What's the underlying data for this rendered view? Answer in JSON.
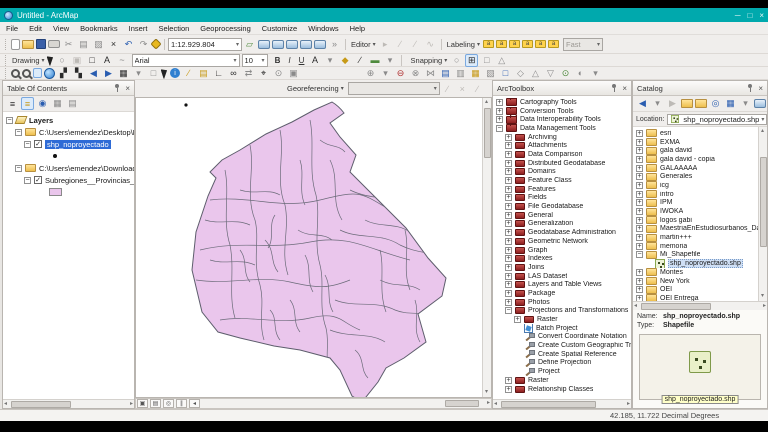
{
  "window": {
    "title": "Untitled - ArcMap"
  },
  "menu": [
    "File",
    "Edit",
    "View",
    "Bookmarks",
    "Insert",
    "Selection",
    "Geoprocessing",
    "Customize",
    "Windows",
    "Help"
  ],
  "toolbar1": {
    "scale": "1:12.929.804",
    "editor_label": "Editor",
    "labeling_label": "Labeling",
    "fast_value": "Fast",
    "icons_file": [
      {
        "n": "new-map",
        "c": "sh-page"
      },
      {
        "n": "open",
        "c": "sh-folder"
      },
      {
        "n": "save",
        "c": "sh-floppy"
      },
      {
        "n": "print",
        "c": "sh-print"
      },
      {
        "n": "cut",
        "g": "✂",
        "c": "gry"
      },
      {
        "n": "copy",
        "g": "▤",
        "c": "gry"
      },
      {
        "n": "paste",
        "g": "▨",
        "c": "gry"
      },
      {
        "n": "delete",
        "g": "×",
        "c": "blk"
      },
      {
        "n": "undo",
        "g": "↶",
        "c": "blu"
      },
      {
        "n": "redo",
        "g": "↷",
        "c": "gry"
      },
      {
        "n": "add-data",
        "c": "sh-diamond"
      }
    ],
    "icons_map": [
      {
        "n": "map-scale-assistant",
        "g": "▱",
        "c": "grn"
      },
      {
        "n": "table-of-contents-window",
        "c": "sh-win"
      },
      {
        "n": "catalog-window",
        "c": "sh-win"
      },
      {
        "n": "search-window",
        "c": "sh-win"
      },
      {
        "n": "arctoolbox-window",
        "c": "sh-win"
      },
      {
        "n": "python-window",
        "c": "sh-win"
      },
      {
        "n": "model-builder",
        "g": "»",
        "c": "gry"
      }
    ],
    "icons_editor": [
      {
        "n": "edit-tool",
        "g": "▸",
        "c": "dis"
      },
      {
        "n": "edit-annotation-tool",
        "g": "∕",
        "c": "dis"
      },
      {
        "n": "straight-segment-tool",
        "g": "∕",
        "c": "dis"
      },
      {
        "n": "trace-tool",
        "g": "∿",
        "c": "dis"
      }
    ],
    "icons_label": [
      {
        "n": "label-manager",
        "c": "sh-tag",
        "g": "a"
      },
      {
        "n": "label-priority-ranking",
        "c": "sh-tag",
        "g": "a"
      },
      {
        "n": "label-weight-ranking",
        "c": "sh-tag",
        "g": "a"
      },
      {
        "n": "lock-labels",
        "c": "sh-tag",
        "g": "a"
      },
      {
        "n": "pause-labeling",
        "c": "sh-tag",
        "g": "a"
      },
      {
        "n": "view-unplaced-labels",
        "c": "sh-tag",
        "g": "a"
      }
    ]
  },
  "toolbar2": {
    "drawing_label": "Drawing",
    "font_value": "Arial",
    "size_value": "10",
    "bold_label": "B",
    "italic_label": "I",
    "underline_label": "U",
    "snapping_label": "Snapping",
    "icons_draw": [
      {
        "n": "select-elements",
        "c": "sh-cursor"
      },
      {
        "n": "rotate-element",
        "g": "○",
        "c": "gry"
      },
      {
        "n": "zoom-to-selected",
        "g": "▣",
        "c": "dis"
      },
      {
        "n": "shape-dropdown",
        "g": "□",
        "c": "blk"
      },
      {
        "n": "text-tool",
        "g": "A",
        "c": "blk"
      },
      {
        "n": "curve-tool",
        "g": "~",
        "c": "gry"
      }
    ],
    "icons_fmt": [
      {
        "n": "font-color",
        "g": "A",
        "c": "blk"
      },
      {
        "n": "font-color-dropdown",
        "g": "▾",
        "c": "gry"
      },
      {
        "n": "marker-color",
        "g": "◆",
        "c": "yel"
      },
      {
        "n": "line-color",
        "g": "∕",
        "c": "blk"
      },
      {
        "n": "fill-color",
        "g": "▬",
        "c": "grn"
      },
      {
        "n": "fill-color-dropdown",
        "g": "▾",
        "c": "gry"
      }
    ],
    "icons_snap": [
      {
        "n": "point-snapping",
        "g": "○",
        "c": "gry"
      },
      {
        "n": "end-snapping",
        "g": "⊞",
        "c": "blk on"
      },
      {
        "n": "vertex-snapping",
        "g": "□",
        "c": "gry"
      },
      {
        "n": "edge-snapping",
        "g": "△",
        "c": "gry"
      }
    ]
  },
  "toolbar3": {
    "icons_nav": [
      {
        "n": "zoom-in",
        "c": "sh-mag"
      },
      {
        "n": "zoom-out",
        "c": "sh-mag"
      },
      {
        "n": "pan",
        "c": "sh-hand on"
      },
      {
        "n": "full-extent",
        "c": "sh-globe"
      },
      {
        "n": "fixed-zoom-in",
        "g": "▞",
        "c": "blk"
      },
      {
        "n": "fixed-zoom-out",
        "g": "▚",
        "c": "blk"
      },
      {
        "n": "go-back-extent",
        "g": "◀",
        "c": "blu"
      },
      {
        "n": "go-forward-extent",
        "g": "▶",
        "c": "blu"
      },
      {
        "n": "select-features",
        "g": "▦",
        "c": "blk"
      },
      {
        "n": "selection-dropdown",
        "g": "▾",
        "c": "gry"
      },
      {
        "n": "clear-selected-features",
        "g": "□",
        "c": "gry"
      },
      {
        "n": "select-elements-tool",
        "c": "sh-cursor"
      },
      {
        "n": "identify",
        "g": "i",
        "c": "sh-info"
      },
      {
        "n": "hyperlink",
        "g": "∕",
        "c": "yel"
      },
      {
        "n": "html-popup",
        "g": "▤",
        "c": "yel"
      },
      {
        "n": "measure",
        "g": "∟",
        "c": "blk"
      },
      {
        "n": "find",
        "g": "∞",
        "c": "blk"
      },
      {
        "n": "find-route",
        "g": "⇄",
        "c": "gry"
      },
      {
        "n": "go-to-xy",
        "g": "⌖",
        "c": "blk"
      },
      {
        "n": "time-slider",
        "g": "⊙",
        "c": "gry"
      },
      {
        "n": "create-viewer-window",
        "g": "▣",
        "c": "gry"
      }
    ],
    "icons_adjust": [
      {
        "n": "add-control-points",
        "g": "⊕",
        "c": "gry"
      },
      {
        "n": "update-georeferencing",
        "g": "▾",
        "c": "gry"
      },
      {
        "n": "rotate-raster",
        "g": "⊖",
        "c": "red"
      },
      {
        "n": "shift-raster",
        "g": "⊗",
        "c": "gry"
      },
      {
        "n": "scale-raster",
        "g": "⋈",
        "c": "gry"
      },
      {
        "n": "transform",
        "g": "▤",
        "c": "blu"
      },
      {
        "n": "zoom-raster",
        "g": "▥",
        "c": "gry"
      },
      {
        "n": "pan-raster",
        "g": "▦",
        "c": "yel"
      },
      {
        "n": "auto-registration",
        "g": "▧",
        "c": "gry"
      },
      {
        "n": "view-link-table",
        "g": "□",
        "c": "blu"
      },
      {
        "n": "viewer",
        "g": "◇",
        "c": "gry"
      },
      {
        "n": "swipe",
        "g": "△",
        "c": "gry"
      },
      {
        "n": "flicker",
        "g": "▽",
        "c": "gry"
      },
      {
        "n": "effects",
        "g": "⊙",
        "c": "grn"
      },
      {
        "n": "contrast",
        "g": "◐",
        "c": "gry"
      },
      {
        "n": "brightness",
        "g": "▾",
        "c": "gry"
      }
    ]
  },
  "georef": {
    "label": "Georeferencing"
  },
  "toc": {
    "title": "Table Of Contents",
    "toolbar": [
      {
        "n": "list-by-drawing-order",
        "g": "≡",
        "c": "blk"
      },
      {
        "n": "list-by-source",
        "g": "≡",
        "c": "yel on"
      },
      {
        "n": "list-by-visibility",
        "g": "◉",
        "c": "blu"
      },
      {
        "n": "list-by-selection",
        "g": "▦",
        "c": "gry"
      },
      {
        "n": "toc-options",
        "g": "▤",
        "c": "gry"
      }
    ],
    "tree": [
      {
        "lvl": 0,
        "exp": "-",
        "icon": "layers",
        "label": "Layers",
        "bold": true
      },
      {
        "lvl": 1,
        "exp": "-",
        "icon": "folder",
        "label": "C:\\Users\\emendez\\Desktop\\Mi_Shapefile"
      },
      {
        "lvl": 2,
        "exp": "-",
        "chk": true,
        "label": "shp_noproyectado",
        "sel": true
      },
      {
        "lvl": 3,
        "icon": "dot"
      },
      {
        "lvl": 1,
        "exp": "-",
        "icon": "folder",
        "label": "C:\\Users\\emendez\\Downloads\\Subregione"
      },
      {
        "lvl": 2,
        "exp": "-",
        "chk": true,
        "label": "Subregiones__Provincias_de_Colombia"
      },
      {
        "lvl": 3,
        "icon": "swatch"
      }
    ]
  },
  "arctoolbox": {
    "title": "ArcToolbox",
    "tree": [
      {
        "lvl": 0,
        "exp": "+",
        "icon": "toolbox",
        "label": "Cartography Tools"
      },
      {
        "lvl": 0,
        "exp": "+",
        "icon": "toolbox",
        "label": "Conversion Tools"
      },
      {
        "lvl": 0,
        "exp": "+",
        "icon": "toolbox",
        "label": "Data Interoperability Tools"
      },
      {
        "lvl": 0,
        "exp": "-",
        "icon": "toolbox",
        "label": "Data Management Tools"
      },
      {
        "lvl": 1,
        "exp": "+",
        "icon": "toolset",
        "label": "Archiving"
      },
      {
        "lvl": 1,
        "exp": "+",
        "icon": "toolset",
        "label": "Attachments"
      },
      {
        "lvl": 1,
        "exp": "+",
        "icon": "toolset",
        "label": "Data Comparison"
      },
      {
        "lvl": 1,
        "exp": "+",
        "icon": "toolset",
        "label": "Distributed Geodatabase"
      },
      {
        "lvl": 1,
        "exp": "+",
        "icon": "toolset",
        "label": "Domains"
      },
      {
        "lvl": 1,
        "exp": "+",
        "icon": "toolset",
        "label": "Feature Class"
      },
      {
        "lvl": 1,
        "exp": "+",
        "icon": "toolset",
        "label": "Features"
      },
      {
        "lvl": 1,
        "exp": "+",
        "icon": "toolset",
        "label": "Fields"
      },
      {
        "lvl": 1,
        "exp": "+",
        "icon": "toolset",
        "label": "File Geodatabase"
      },
      {
        "lvl": 1,
        "exp": "+",
        "icon": "toolset",
        "label": "General"
      },
      {
        "lvl": 1,
        "exp": "+",
        "icon": "toolset",
        "label": "Generalization"
      },
      {
        "lvl": 1,
        "exp": "+",
        "icon": "toolset",
        "label": "Geodatabase Administration"
      },
      {
        "lvl": 1,
        "exp": "+",
        "icon": "toolset",
        "label": "Geometric Network"
      },
      {
        "lvl": 1,
        "exp": "+",
        "icon": "toolset",
        "label": "Graph"
      },
      {
        "lvl": 1,
        "exp": "+",
        "icon": "toolset",
        "label": "Indexes"
      },
      {
        "lvl": 1,
        "exp": "+",
        "icon": "toolset",
        "label": "Joins"
      },
      {
        "lvl": 1,
        "exp": "+",
        "icon": "toolset",
        "label": "LAS Dataset"
      },
      {
        "lvl": 1,
        "exp": "+",
        "icon": "toolset",
        "label": "Layers and Table Views"
      },
      {
        "lvl": 1,
        "exp": "+",
        "icon": "toolset",
        "label": "Package"
      },
      {
        "lvl": 1,
        "exp": "+",
        "icon": "toolset",
        "label": "Photos"
      },
      {
        "lvl": 1,
        "exp": "-",
        "icon": "toolset",
        "label": "Projections and Transformations"
      },
      {
        "lvl": 2,
        "exp": "+",
        "icon": "toolset",
        "label": "Raster"
      },
      {
        "lvl": 2,
        "icon": "script",
        "label": "Batch Project"
      },
      {
        "lvl": 2,
        "icon": "tool",
        "label": "Convert Coordinate Notation"
      },
      {
        "lvl": 2,
        "icon": "tool",
        "label": "Create Custom Geographic Trans"
      },
      {
        "lvl": 2,
        "icon": "tool",
        "label": "Create Spatial Reference"
      },
      {
        "lvl": 2,
        "icon": "tool",
        "label": "Define Projection"
      },
      {
        "lvl": 2,
        "icon": "tool",
        "label": "Project"
      },
      {
        "lvl": 1,
        "exp": "+",
        "icon": "toolset",
        "label": "Raster"
      },
      {
        "lvl": 1,
        "exp": "+",
        "icon": "toolset",
        "label": "Relationship Classes"
      }
    ]
  },
  "catalog": {
    "title": "Catalog",
    "toolbar": [
      {
        "n": "back",
        "g": "◀",
        "c": "blu"
      },
      {
        "n": "back-dropdown",
        "g": "▾",
        "c": "gry"
      },
      {
        "n": "forward",
        "g": "▶",
        "c": "dis"
      },
      {
        "n": "up-one-level",
        "c": "sh-folder"
      },
      {
        "n": "connect-to-folder",
        "c": "sh-folder"
      },
      {
        "n": "refresh",
        "g": "◎",
        "c": "blu"
      },
      {
        "n": "contents-view",
        "g": "▦",
        "c": "blu"
      },
      {
        "n": "view-dropdown",
        "g": "▾",
        "c": "gry"
      },
      {
        "n": "launch-window",
        "c": "sh-win"
      },
      {
        "n": "catalog-overflow",
        "g": "▾",
        "c": "gry"
      }
    ],
    "location_label": "Location:",
    "location_value": "shp_noproyectado.shp",
    "tree": [
      {
        "lvl": 0,
        "exp": "+",
        "icon": "folder",
        "label": "esri"
      },
      {
        "lvl": 0,
        "exp": "+",
        "icon": "folder",
        "label": "EXMA"
      },
      {
        "lvl": 0,
        "exp": "+",
        "icon": "folder",
        "label": "gala david"
      },
      {
        "lvl": 0,
        "exp": "+",
        "icon": "folder",
        "label": "gala david - copia"
      },
      {
        "lvl": 0,
        "exp": "+",
        "icon": "folder",
        "label": "GALAAAAA"
      },
      {
        "lvl": 0,
        "exp": "+",
        "icon": "folder",
        "label": "Generales"
      },
      {
        "lvl": 0,
        "exp": "+",
        "icon": "folder",
        "label": "icg"
      },
      {
        "lvl": 0,
        "exp": "+",
        "icon": "folder",
        "label": "intro"
      },
      {
        "lvl": 0,
        "exp": "+",
        "icon": "folder",
        "label": "IPM"
      },
      {
        "lvl": 0,
        "exp": "+",
        "icon": "folder",
        "label": "IWOKA"
      },
      {
        "lvl": 0,
        "exp": "+",
        "icon": "folder",
        "label": "logos gabi"
      },
      {
        "lvl": 0,
        "exp": "+",
        "icon": "folder",
        "label": "MaestriaEnEstudiosurbanos_DavidMen"
      },
      {
        "lvl": 0,
        "exp": "+",
        "icon": "folder",
        "label": "martin+++"
      },
      {
        "lvl": 0,
        "exp": "+",
        "icon": "folder",
        "label": "memoria"
      },
      {
        "lvl": 0,
        "exp": "-",
        "icon": "folder",
        "label": "Mi_Shapefile"
      },
      {
        "lvl": 1,
        "icon": "shp",
        "label": "shp_noproyectado.shp",
        "sel2": true
      },
      {
        "lvl": 0,
        "exp": "+",
        "icon": "folder",
        "label": "Montes"
      },
      {
        "lvl": 0,
        "exp": "+",
        "icon": "folder",
        "label": "New York"
      },
      {
        "lvl": 0,
        "exp": "+",
        "icon": "folder",
        "label": "OEI"
      },
      {
        "lvl": 0,
        "exp": "+",
        "icon": "folder",
        "label": "OEI Entrega"
      }
    ],
    "info": {
      "name_label": "Name:",
      "name_value": "shp_noproyectado.shp",
      "type_label": "Type:",
      "type_value": "Shapefile",
      "preview_caption": "shp_noproyectado.shp"
    }
  },
  "statusbar": {
    "coords": "42.185, 11.722 Decimal Degrees"
  },
  "colors": {
    "titlebar_teal": "#00a9ad",
    "selection_blue": "#2e6bd6",
    "map_fill": "#eac6ec",
    "map_stroke": "#5d5d6c"
  }
}
